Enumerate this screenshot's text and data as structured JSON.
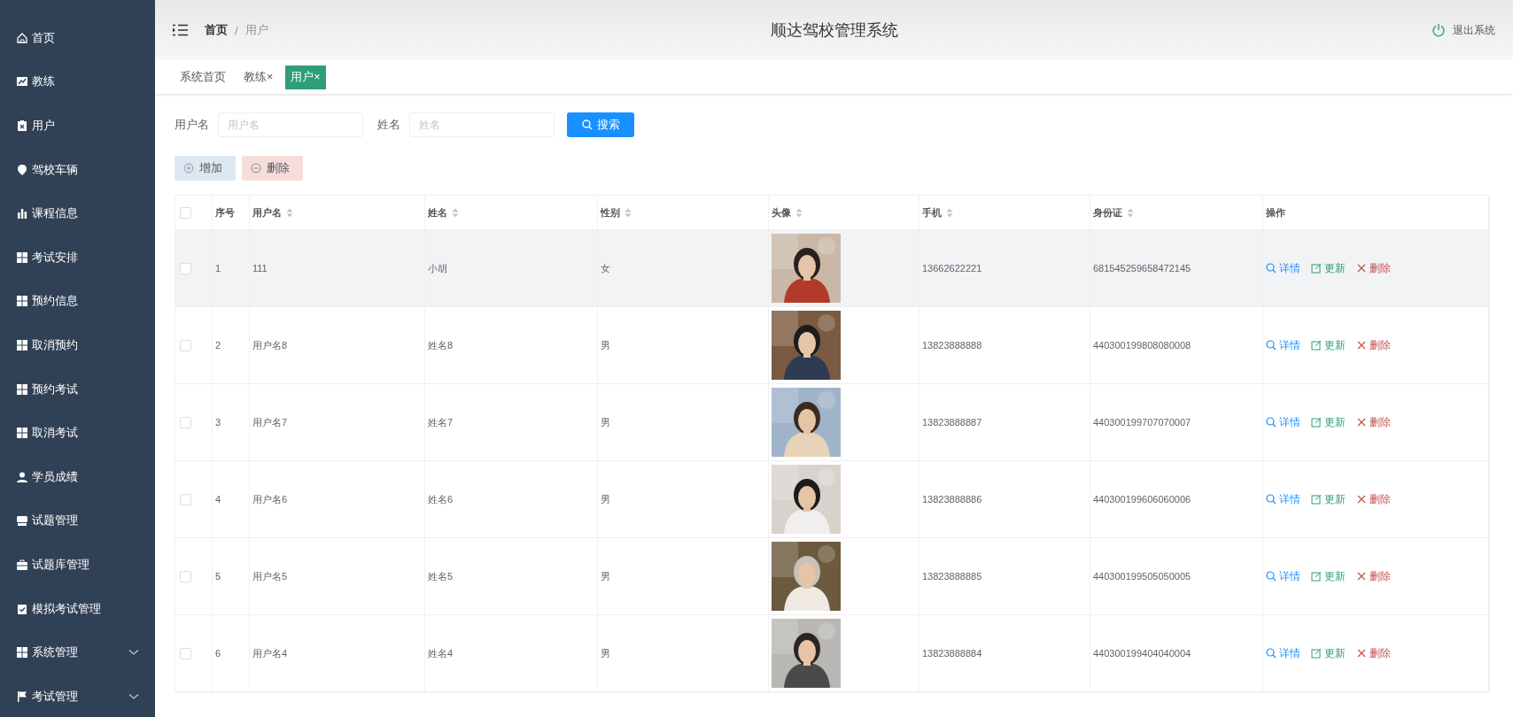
{
  "sidebar": {
    "items": [
      {
        "label": "首页",
        "expandable": false
      },
      {
        "label": "教练",
        "expandable": false
      },
      {
        "label": "用户",
        "expandable": false
      },
      {
        "label": "驾校车辆",
        "expandable": false
      },
      {
        "label": "课程信息",
        "expandable": false
      },
      {
        "label": "考试安排",
        "expandable": false
      },
      {
        "label": "预约信息",
        "expandable": false
      },
      {
        "label": "取消预约",
        "expandable": false
      },
      {
        "label": "预约考试",
        "expandable": false
      },
      {
        "label": "取消考试",
        "expandable": false
      },
      {
        "label": "学员成绩",
        "expandable": false
      },
      {
        "label": "试题管理",
        "expandable": false
      },
      {
        "label": "试题库管理",
        "expandable": false
      },
      {
        "label": "模拟考试管理",
        "expandable": false
      },
      {
        "label": "系统管理",
        "expandable": true
      },
      {
        "label": "考试管理",
        "expandable": true
      }
    ]
  },
  "header": {
    "breadcrumb": [
      "首页",
      "用户"
    ],
    "breadcrumb_separator": "/",
    "title": "顺达驾校管理系统",
    "logout": "退出系统"
  },
  "tabs": [
    {
      "label": "系统首页",
      "selected": false
    },
    {
      "label": "教练×",
      "selected": false
    },
    {
      "label": "用户×",
      "selected": true
    }
  ],
  "search": {
    "fields": [
      {
        "label": "用户名",
        "placeholder": "用户名"
      },
      {
        "label": "姓名",
        "placeholder": "姓名"
      }
    ],
    "button": "搜索"
  },
  "actions": {
    "add": "增加",
    "delete": "删除"
  },
  "table": {
    "all_checked": false,
    "columns": [
      {
        "label": "序号",
        "sortable": false
      },
      {
        "label": "用户名",
        "sortable": true
      },
      {
        "label": "姓名",
        "sortable": true
      },
      {
        "label": "性别",
        "sortable": true
      },
      {
        "label": "头像",
        "sortable": true
      },
      {
        "label": "手机",
        "sortable": true
      },
      {
        "label": "身份证",
        "sortable": true
      },
      {
        "label": "操作",
        "sortable": false
      }
    ],
    "rows": [
      {
        "index": "1",
        "username": "111",
        "name": "小胡",
        "gender": "女",
        "phone": "13662622221",
        "id_card": "681545259658472145",
        "actions": [
          "详情",
          "更新",
          "删除"
        ],
        "checked": false,
        "hovered": true
      },
      {
        "index": "2",
        "username": "用户名8",
        "name": "姓名8",
        "gender": "男",
        "phone": "13823888888",
        "id_card": "440300199808080008",
        "actions": [
          "详情",
          "更新",
          "删除"
        ],
        "checked": false,
        "hovered": false
      },
      {
        "index": "3",
        "username": "用户名7",
        "name": "姓名7",
        "gender": "男",
        "phone": "13823888887",
        "id_card": "440300199707070007",
        "actions": [
          "详情",
          "更新",
          "删除"
        ],
        "checked": false,
        "hovered": false
      },
      {
        "index": "4",
        "username": "用户名6",
        "name": "姓名6",
        "gender": "男",
        "phone": "13823888886",
        "id_card": "440300199606060006",
        "actions": [
          "详情",
          "更新",
          "删除"
        ],
        "checked": false,
        "hovered": false
      },
      {
        "index": "5",
        "username": "用户名5",
        "name": "姓名5",
        "gender": "男",
        "phone": "13823888885",
        "id_card": "440300199505050005",
        "actions": [
          "详情",
          "更新",
          "删除"
        ],
        "checked": false,
        "hovered": false
      },
      {
        "index": "6",
        "username": "用户名4",
        "name": "姓名4",
        "gender": "男",
        "phone": "13823888884",
        "id_card": "440300199404040004",
        "actions": [
          "详情",
          "更新",
          "删除"
        ],
        "checked": false,
        "hovered": false
      }
    ]
  }
}
